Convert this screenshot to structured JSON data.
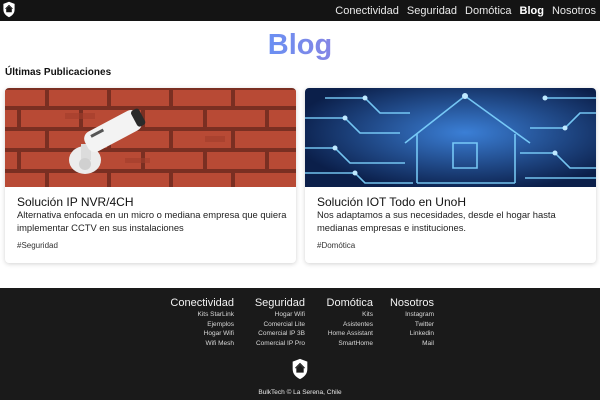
{
  "nav": {
    "items": [
      "Conectividad",
      "Seguridad",
      "Domótica",
      "Blog",
      "Nosotros"
    ],
    "active": "Blog"
  },
  "header": {
    "title": "Blog"
  },
  "section": {
    "title": "Últimas Publicaciones"
  },
  "cards": [
    {
      "image": "security-camera-on-brick-wall",
      "title": "Solución IP NVR/4CH",
      "text": "Alternativa enfocada en un micro o mediana empresa que quiera implementar CCTV en sus instalaciones",
      "tag": "#Seguridad"
    },
    {
      "image": "circuit-house-illustration",
      "title": "Solución IOT Todo en UnoH",
      "text": "Nos adaptamos a sus necesidades, desde el hogar hasta medianas empresas e instituciones.",
      "tag": "#Domótica"
    }
  ],
  "footer": {
    "columns": [
      {
        "title": "Conectividad",
        "links": [
          "Kits StarLink",
          "Ejemplos",
          "Hogar Wifi",
          "Wifi Mesh"
        ]
      },
      {
        "title": "Seguridad",
        "links": [
          "Hogar Wifi",
          "Comercial Lite",
          "Comercial IP 3B",
          "Comercial IP Pro"
        ]
      },
      {
        "title": "Domótica",
        "links": [
          "Kits",
          "Asistentes",
          "Home Assistant",
          "SmartHome"
        ]
      },
      {
        "title": "Nosotros",
        "links": [
          "Instagram",
          "Twitter",
          "Linkedin",
          "Mail"
        ]
      }
    ],
    "copyright": "BulkTech © La Serena, Chile"
  },
  "colors": {
    "topbar": "#141414",
    "footer": "#1a1a1a",
    "gradient_start": "#2ec5ef",
    "gradient_end": "#f25ba9"
  }
}
